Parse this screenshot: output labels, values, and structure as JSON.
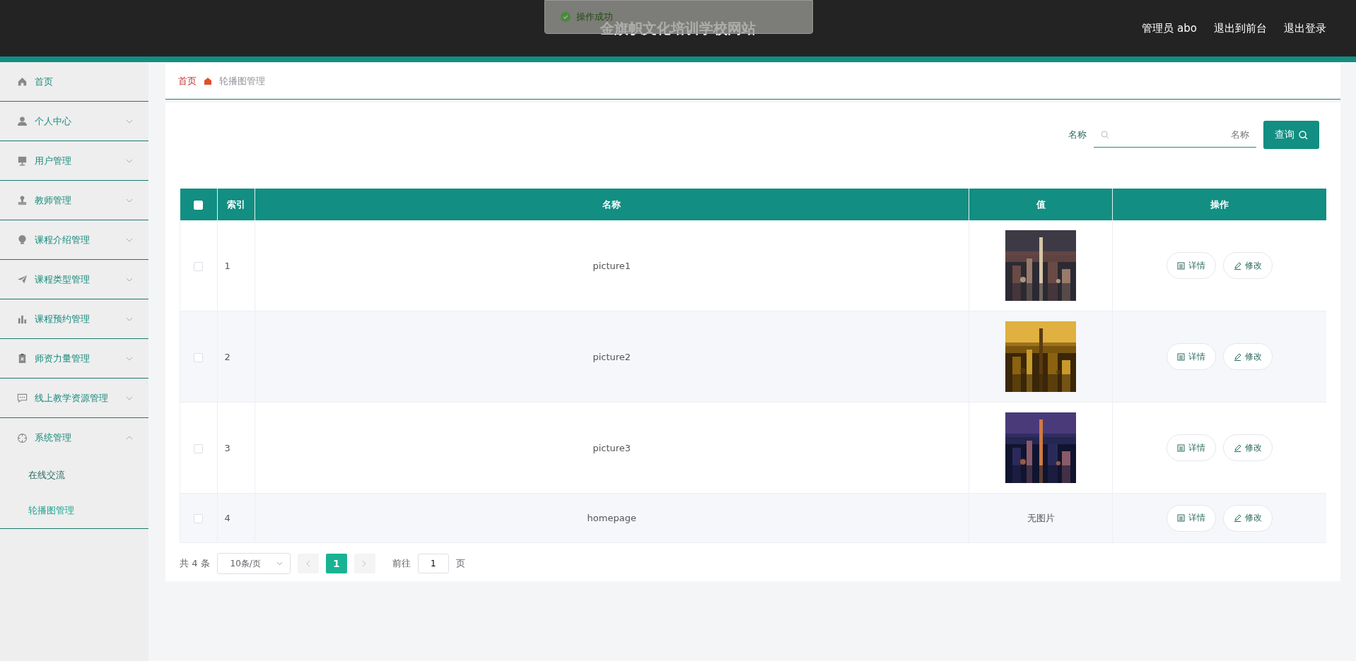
{
  "toast": {
    "text": "操作成功"
  },
  "header": {
    "title": "金旗帜文化培训学校网站",
    "links": [
      "管理员 abo",
      "退出到前台",
      "退出登录"
    ]
  },
  "sidebar": {
    "items": [
      {
        "label": "首页"
      },
      {
        "label": "个人中心",
        "expanded": false
      },
      {
        "label": "用户管理",
        "expanded": false
      },
      {
        "label": "教师管理",
        "expanded": false
      },
      {
        "label": "课程介绍管理",
        "expanded": false
      },
      {
        "label": "课程类型管理",
        "expanded": false
      },
      {
        "label": "课程预约管理",
        "expanded": false
      },
      {
        "label": "师资力量管理",
        "expanded": false
      },
      {
        "label": "线上教学资源管理",
        "expanded": false
      },
      {
        "label": "系统管理",
        "expanded": true,
        "children": [
          {
            "label": "在线交流",
            "selected": false
          },
          {
            "label": "轮播图管理",
            "selected": true
          }
        ]
      }
    ]
  },
  "breadcrumb": [
    "首页",
    "轮播图管理"
  ],
  "search": {
    "label": "名称",
    "placeholder": "名称",
    "button": "查询"
  },
  "table": {
    "all_checked": false,
    "columns": [
      "索引",
      "名称",
      "值",
      "操作"
    ],
    "rows": [
      {
        "checked": false,
        "index": "1",
        "name": "picture1",
        "value": {
          "kind": "picture"
        },
        "actions": [
          "详情",
          "修改"
        ]
      },
      {
        "checked": false,
        "index": "2",
        "name": "picture2",
        "value": {
          "kind": "picture"
        },
        "actions": [
          "详情",
          "修改"
        ]
      },
      {
        "checked": false,
        "index": "3",
        "name": "picture3",
        "value": {
          "kind": "picture"
        },
        "actions": [
          "详情",
          "修改"
        ]
      },
      {
        "checked": false,
        "index": "4",
        "name": "homepage",
        "value": {
          "kind": "text",
          "text": "无图片"
        },
        "actions": [
          "详情",
          "修改"
        ]
      }
    ]
  },
  "pagination": {
    "total": "共 4 条",
    "page_size": "10条/页",
    "pages": [
      {
        "label": "1",
        "selected": true
      }
    ],
    "goto_label": "前往",
    "goto_value": "1",
    "goto_suffix": "页"
  }
}
